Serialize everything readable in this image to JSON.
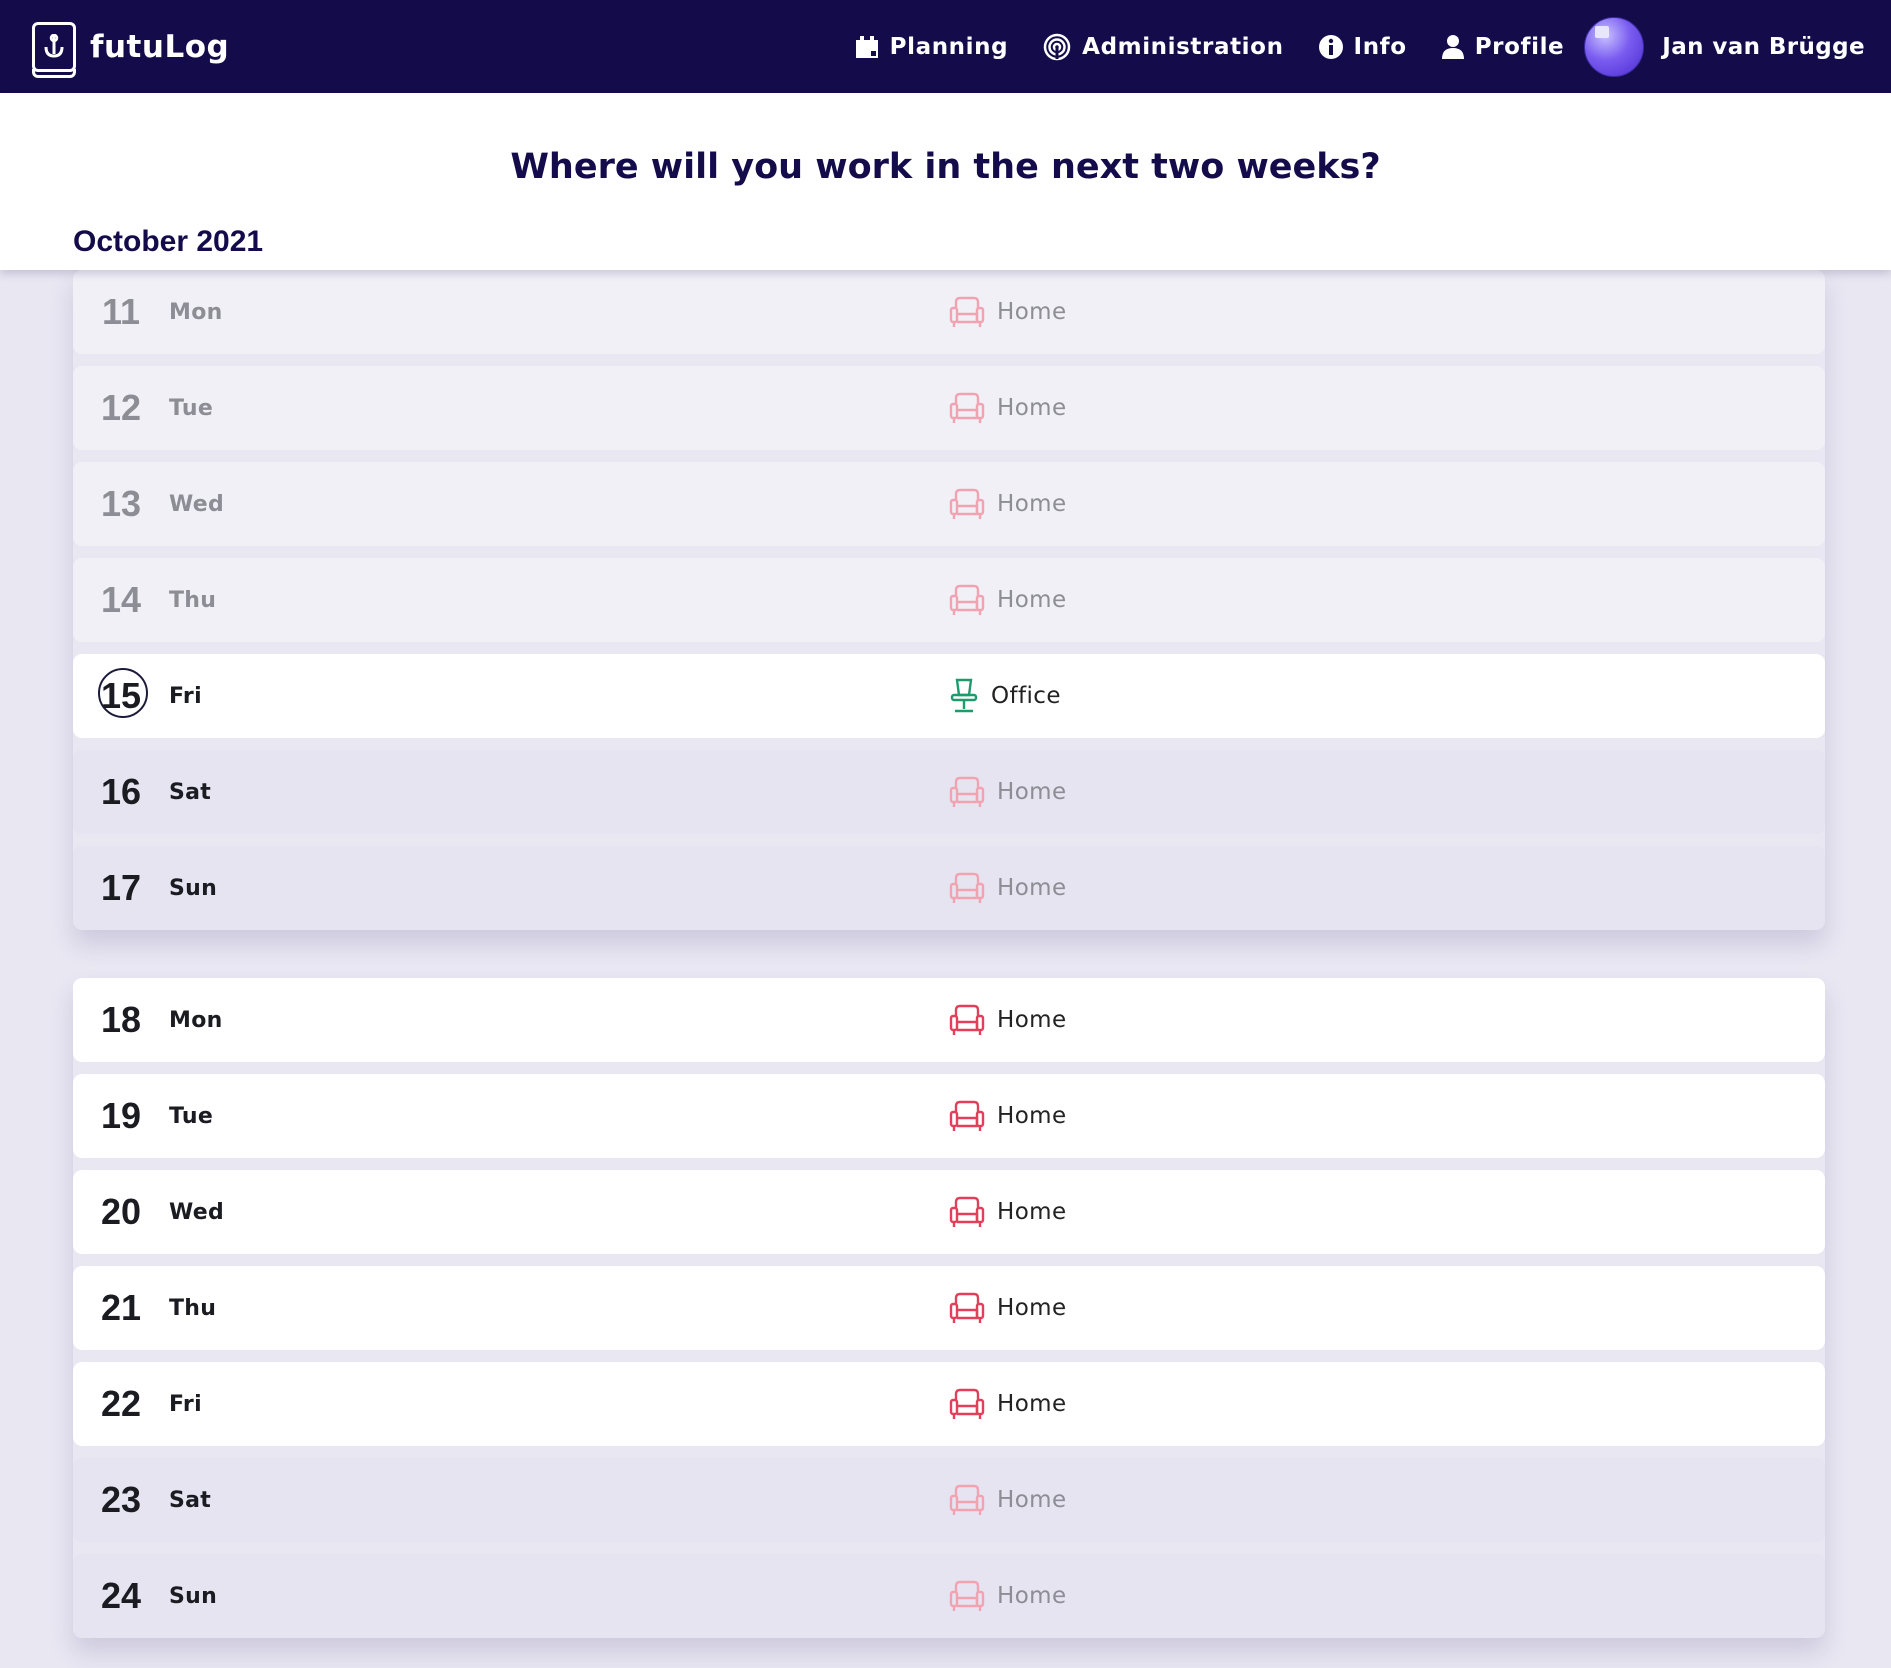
{
  "app": {
    "name": "futuLog"
  },
  "nav": {
    "planning": "Planning",
    "administration": "Administration",
    "info": "Info",
    "profile": "Profile",
    "username": "Jan van Brügge"
  },
  "page": {
    "title": "Where will you work in the next two weeks?",
    "month": "October 2021"
  },
  "colors": {
    "navbar": "#140c4a",
    "home_icon_active": "#e2405a",
    "home_icon_muted": "#f2a3b2",
    "office_icon": "#1f9a6d"
  },
  "days": [
    {
      "num": "11",
      "name": "Mon",
      "location": "Home",
      "icon": "armchair-icon",
      "state": "past"
    },
    {
      "num": "12",
      "name": "Tue",
      "location": "Home",
      "icon": "armchair-icon",
      "state": "past"
    },
    {
      "num": "13",
      "name": "Wed",
      "location": "Home",
      "icon": "armchair-icon",
      "state": "past"
    },
    {
      "num": "14",
      "name": "Thu",
      "location": "Home",
      "icon": "armchair-icon",
      "state": "past"
    },
    {
      "num": "15",
      "name": "Fri",
      "location": "Office",
      "icon": "office-chair-icon",
      "state": "today"
    },
    {
      "num": "16",
      "name": "Sat",
      "location": "Home",
      "icon": "armchair-icon",
      "state": "weekend"
    },
    {
      "num": "17",
      "name": "Sun",
      "location": "Home",
      "icon": "armchair-icon",
      "state": "weekend"
    },
    {
      "num": "18",
      "name": "Mon",
      "location": "Home",
      "icon": "armchair-icon",
      "state": "upcoming"
    },
    {
      "num": "19",
      "name": "Tue",
      "location": "Home",
      "icon": "armchair-icon",
      "state": "upcoming"
    },
    {
      "num": "20",
      "name": "Wed",
      "location": "Home",
      "icon": "armchair-icon",
      "state": "upcoming"
    },
    {
      "num": "21",
      "name": "Thu",
      "location": "Home",
      "icon": "armchair-icon",
      "state": "upcoming"
    },
    {
      "num": "22",
      "name": "Fri",
      "location": "Home",
      "icon": "armchair-icon",
      "state": "upcoming"
    },
    {
      "num": "23",
      "name": "Sat",
      "location": "Home",
      "icon": "armchair-icon",
      "state": "weekend"
    },
    {
      "num": "24",
      "name": "Sun",
      "location": "Home",
      "icon": "armchair-icon",
      "state": "weekend"
    }
  ]
}
